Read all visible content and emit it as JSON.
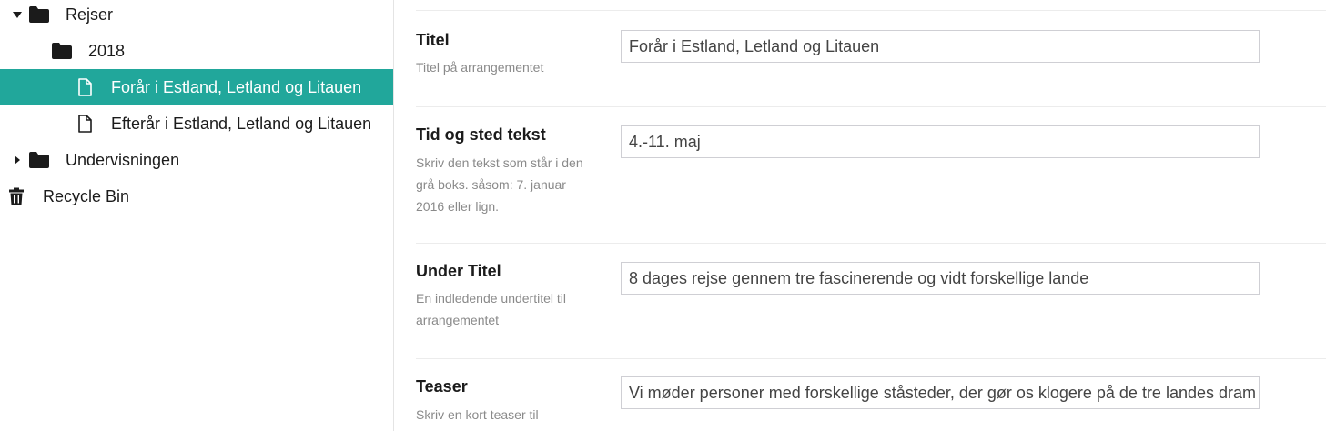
{
  "tree": {
    "items": [
      {
        "label": "Rejser",
        "icon": "folder-icon",
        "expanded": true
      },
      {
        "label": "2018",
        "icon": "folder-icon"
      },
      {
        "label": "Forår i Estland, Letland og Litauen",
        "icon": "document-icon",
        "selected": true
      },
      {
        "label": "Efterår i Estland, Letland og Litauen",
        "icon": "document-icon"
      },
      {
        "label": "Undervisningen",
        "icon": "folder-icon",
        "expanded": false
      },
      {
        "label": "Recycle Bin",
        "icon": "trash-icon"
      }
    ],
    "selected_color": "#21a79b"
  },
  "form": {
    "fields": [
      {
        "label": "Titel",
        "description": "Titel på arrangementet",
        "value": "Forår i Estland, Letland og Litauen"
      },
      {
        "label": "Tid og sted tekst",
        "description": "Skriv den tekst som står i den grå boks. såsom: 7. januar 2016 eller lign.",
        "value": "4.-11. maj"
      },
      {
        "label": "Under Titel",
        "description": "En indledende undertitel til arrangementet",
        "value": "8 dages rejse gennem tre fascinerende og vidt forskellige lande"
      },
      {
        "label": "Teaser",
        "description": "Skriv en kort teaser til",
        "value": "Vi møder personer med forskellige ståsteder, der gør os klogere på de tre landes dram"
      }
    ]
  }
}
